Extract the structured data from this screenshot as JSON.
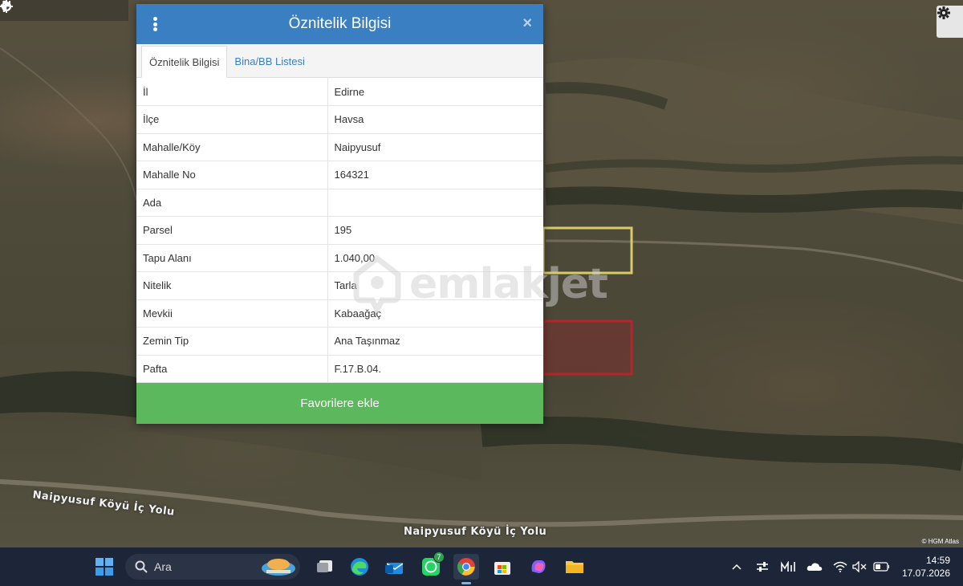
{
  "map": {
    "toolbar": [
      {
        "name": "zoom-in",
        "glyph": "+"
      },
      {
        "name": "zoom-out",
        "glyph": "−"
      },
      {
        "name": "refresh",
        "glyph": "⟳"
      },
      {
        "name": "locate",
        "glyph": "⌖"
      },
      {
        "name": "info",
        "glyph": "i"
      }
    ],
    "road_labels": [
      "Naipyusuf Köyü İç Yolu",
      "Naipyusuf Köyü İç Yolu"
    ],
    "attribution": "© HGM Atlas",
    "watermark": "emlakjet",
    "parcel_colors": {
      "yellow": "#d8cc6a",
      "red": "#b4252c"
    }
  },
  "popup": {
    "title": "Öznitelik Bilgisi",
    "close_glyph": "×",
    "tabs": [
      "Öznitelik Bilgisi",
      "Bina/BB Listesi"
    ],
    "rows": [
      {
        "key": "İl",
        "value": "Edirne"
      },
      {
        "key": "İlçe",
        "value": "Havsa"
      },
      {
        "key": "Mahalle/Köy",
        "value": "Naipyusuf"
      },
      {
        "key": "Mahalle No",
        "value": "164321"
      },
      {
        "key": "Ada",
        "value": ""
      },
      {
        "key": "Parsel",
        "value": "195"
      },
      {
        "key": "Tapu Alanı",
        "value": "1.040,00"
      },
      {
        "key": "Nitelik",
        "value": "Tarla"
      },
      {
        "key": "Mevkii",
        "value": "Kabaağaç"
      },
      {
        "key": "Zemin Tip",
        "value": "Ana Taşınmaz"
      },
      {
        "key": "Pafta",
        "value": "F.17.B.04."
      }
    ],
    "favorite_button": "Favorilere ekle",
    "colors": {
      "header": "#3a7fc1",
      "button": "#5cb85c"
    }
  },
  "taskbar": {
    "search_placeholder": "Ara",
    "whatsapp_badge": "7",
    "time": "14:59",
    "date": "17.07.2026"
  }
}
